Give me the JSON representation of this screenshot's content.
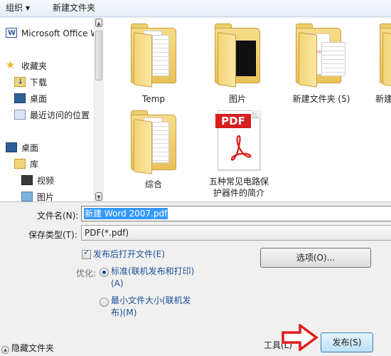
{
  "toolbar": {
    "organize_label": "组织",
    "organize_arrow": "▼",
    "new_folder_label": "新建文件夹"
  },
  "nav": {
    "items": [
      {
        "label": "Microsoft Office W",
        "icon": "word-icon"
      },
      {
        "label": "收藏夹",
        "icon": "star-icon"
      },
      {
        "label": "下载",
        "icon": "download-folder-icon"
      },
      {
        "label": "桌面",
        "icon": "desktop-icon"
      },
      {
        "label": "最近访问的位置",
        "icon": "recent-places-icon"
      },
      {
        "label": "桌面",
        "icon": "desktop-icon"
      },
      {
        "label": "库",
        "icon": "library-icon"
      },
      {
        "label": "视频",
        "icon": "video-library-icon"
      },
      {
        "label": "图片",
        "icon": "pictures-library-icon"
      }
    ]
  },
  "files": [
    {
      "name": "Temp",
      "icon": "folder-icon"
    },
    {
      "name": "图片",
      "icon": "folder-icon"
    },
    {
      "name": "新建文件夹 (5)",
      "icon": "folder-icon"
    },
    {
      "name": "新建",
      "icon": "folder-icon"
    },
    {
      "name": "综合",
      "icon": "folder-icon"
    },
    {
      "name_line1": "五种常见电路保",
      "name_line2": "护器件的简介",
      "badge": "PDF",
      "icon": "pdf-file-icon"
    }
  ],
  "form": {
    "filename_label": "文件名(N):",
    "filename_value": "新建 Word 2007.pdf",
    "filetype_label": "保存类型(T):",
    "filetype_value": "PDF(*.pdf)",
    "open_after_label": "发布后打开文件(E)",
    "open_after_checked": true,
    "optimize_label": "优化:",
    "standard_line1": "标准(联机发布和打印)",
    "standard_line2": "(A)",
    "standard_selected": true,
    "min_line1": "最小文件大小(联机发",
    "min_line2": "布)(M)",
    "options_button": "选项(O)...",
    "hide_folders": "隐藏文件夹",
    "tools_label": "工具(L)",
    "publish_button": "发布(S)"
  },
  "colors": {
    "selection": "#3399ff",
    "link_blue": "#1c4e96",
    "arrow_red": "#e21b1b",
    "pdf_red": "#d71d1d"
  }
}
